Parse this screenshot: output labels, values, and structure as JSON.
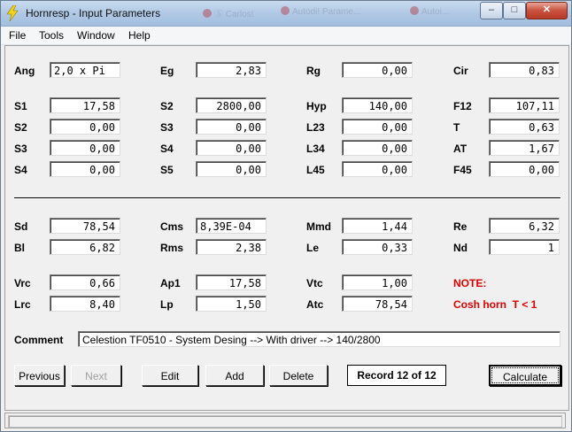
{
  "window": {
    "title": "Hornresp - Input Parameters",
    "background_tabs": [
      "Ⓢ Carlos!",
      "Autodi! Parame...",
      "Autoi..."
    ]
  },
  "menu": [
    "File",
    "Tools",
    "Window",
    "Help"
  ],
  "rows": {
    "ang": {
      "label": "Ang",
      "value": "2,0 x Pi"
    },
    "eg": {
      "label": "Eg",
      "value": "2,83"
    },
    "rg": {
      "label": "Rg",
      "value": "0,00"
    },
    "cir": {
      "label": "Cir",
      "value": "0,83"
    },
    "s1": {
      "label": "S1",
      "value": "17,58"
    },
    "s2": {
      "label": "S2",
      "value": "2800,00"
    },
    "hyp": {
      "label": "Hyp",
      "value": "140,00"
    },
    "f12": {
      "label": "F12",
      "value": "107,11"
    },
    "s2b": {
      "label": "S2",
      "value": "0,00"
    },
    "s3": {
      "label": "S3",
      "value": "0,00"
    },
    "l23": {
      "label": "L23",
      "value": "0,00"
    },
    "t": {
      "label": "T",
      "value": "0,63"
    },
    "s3b": {
      "label": "S3",
      "value": "0,00"
    },
    "s4": {
      "label": "S4",
      "value": "0,00"
    },
    "l34": {
      "label": "L34",
      "value": "0,00"
    },
    "at": {
      "label": "AT",
      "value": "1,67"
    },
    "s4b": {
      "label": "S4",
      "value": "0,00"
    },
    "s5": {
      "label": "S5",
      "value": "0,00"
    },
    "l45": {
      "label": "L45",
      "value": "0,00"
    },
    "f45": {
      "label": "F45",
      "value": "0,00"
    },
    "sd": {
      "label": "Sd",
      "value": "78,54"
    },
    "cms": {
      "label": "Cms",
      "value": "8,39E-04"
    },
    "mmd": {
      "label": "Mmd",
      "value": "1,44"
    },
    "re": {
      "label": "Re",
      "value": "6,32"
    },
    "bl": {
      "label": "Bl",
      "value": "6,82"
    },
    "rms": {
      "label": "Rms",
      "value": "2,38"
    },
    "le": {
      "label": "Le",
      "value": "0,33"
    },
    "nd": {
      "label": "Nd",
      "value": "1"
    },
    "vrc": {
      "label": "Vrc",
      "value": "0,66"
    },
    "ap1": {
      "label": "Ap1",
      "value": "17,58"
    },
    "vtc": {
      "label": "Vtc",
      "value": "1,00"
    },
    "lrc": {
      "label": "Lrc",
      "value": "8,40"
    },
    "lp": {
      "label": "Lp",
      "value": "1,50"
    },
    "atc": {
      "label": "Atc",
      "value": "78,54"
    }
  },
  "note": {
    "title": "NOTE:",
    "text": "Cosh horn  T < 1"
  },
  "comment": {
    "label": "Comment",
    "value": "Celestion TF0510 - System Desing --> With driver --> 140/2800"
  },
  "buttons": {
    "previous": "Previous",
    "next": "Next",
    "edit": "Edit",
    "add": "Add",
    "delete": "Delete",
    "record": "Record 12 of 12",
    "calculate": "Calculate"
  },
  "colors": {
    "note": "#e00000",
    "title_bar": "#aec7e4"
  }
}
